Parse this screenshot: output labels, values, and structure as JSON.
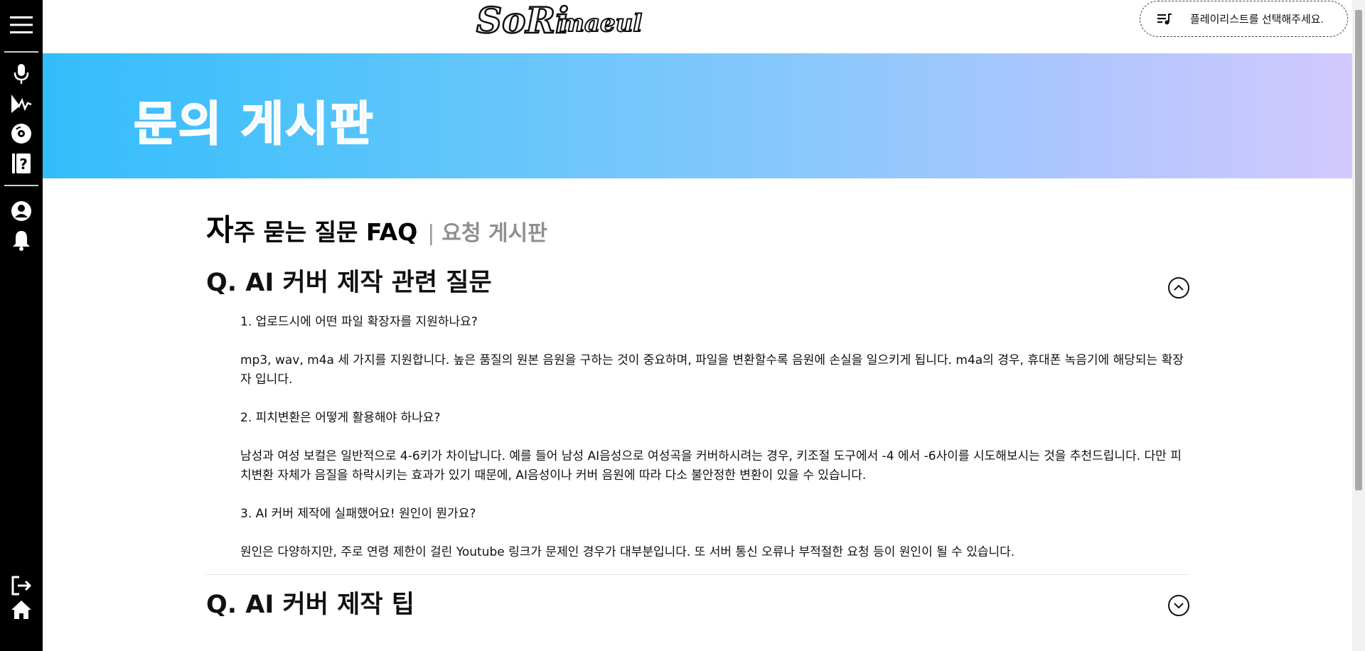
{
  "header": {
    "logo_text": "SoRi maeul",
    "playlist_placeholder": "플레이리스트를 선택해주세요."
  },
  "sidebar": {
    "items": [
      {
        "icon": "menu-icon"
      },
      {
        "icon": "microphone-icon"
      },
      {
        "icon": "voice-wave-icon"
      },
      {
        "icon": "disc-icon"
      },
      {
        "icon": "help-board-icon"
      },
      {
        "icon": "user-icon"
      },
      {
        "icon": "bell-icon"
      },
      {
        "icon": "logout-icon"
      },
      {
        "icon": "home-icon"
      }
    ]
  },
  "banner": {
    "title": "문의 게시판"
  },
  "tabs": {
    "faq_first": "자",
    "faq_rest": "주 묻는 질문 FAQ",
    "separator": "|",
    "request": "요청 게시판"
  },
  "faq": [
    {
      "title": "Q. AI 커버 제작 관련 질문",
      "expanded": true,
      "items": [
        {
          "q": "1. 업로드시에 어떤 파일 확장자를 지원하나요?",
          "a": "mp3, wav, m4a 세 가지를 지원합니다. 높은 품질의 원본 음원을 구하는 것이 중요하며, 파일을 변환할수록 음원에 손실을 일으키게 됩니다. m4a의 경우, 휴대폰 녹음기에 해당되는 확장자 입니다."
        },
        {
          "q": "2. 피치변환은 어떻게 활용해야 하나요?",
          "a": "남성과 여성 보컬은 일반적으로 4-6키가 차이납니다. 예를 들어 남성 AI음성으로 여성곡을 커버하시려는 경우, 키조절 도구에서 -4 에서 -6사이를 시도해보시는 것을 추천드립니다. 다만 피치변환 자체가 음질을 하락시키는 효과가 있기 때문에, AI음성이나 커버 음원에 따라 다소 불안정한 변환이 있을 수 있습니다."
        },
        {
          "q": "3. AI 커버 제작에 실패했어요! 원인이 뭔가요?",
          "a": "원인은 다양하지만, 주로 연령 제한이 걸린 Youtube 링크가 문제인 경우가 대부분입니다. 또 서버 통신 오류나 부적절한 요청 등이 원인이 될 수 있습니다."
        }
      ]
    },
    {
      "title": "Q. AI 커버 제작 팁",
      "expanded": false,
      "items": []
    }
  ],
  "colors": {
    "sidebar_bg": "#000000",
    "banner_start": "#33bdfb",
    "banner_end": "#d2c9fe",
    "tab_inactive": "#8f8f8f"
  }
}
